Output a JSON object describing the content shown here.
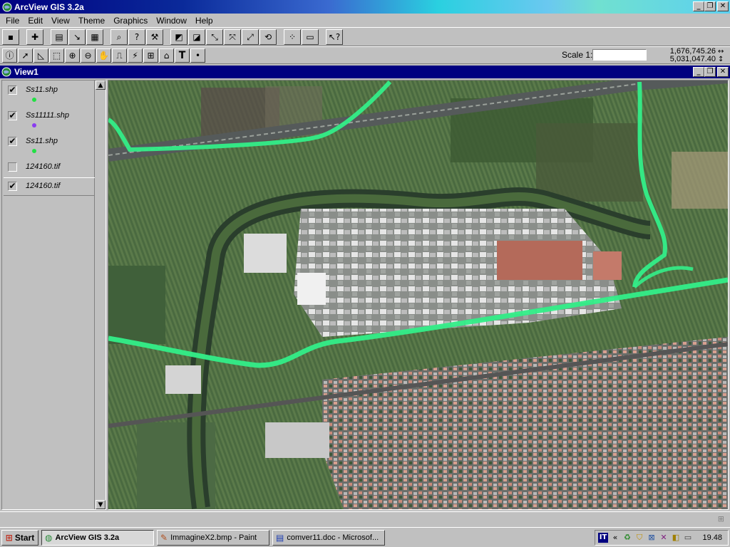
{
  "app": {
    "title": "ArcView GIS 3.2a",
    "window_buttons": {
      "minimize": "_",
      "maximize": "❐",
      "close": "✕"
    }
  },
  "menu": [
    "File",
    "Edit",
    "View",
    "Theme",
    "Graphics",
    "Window",
    "Help"
  ],
  "toolbar_buttons": [
    "save-icon",
    "add-theme-icon",
    "theme-properties-icon",
    "edit-legend-icon",
    "open-table-icon",
    "find-icon",
    "locate-address-icon",
    "query-builder-icon",
    "zoom-full-extent-icon",
    "zoom-active-themes-icon",
    "zoom-selected-icon",
    "zoom-in-icon",
    "zoom-out-icon",
    "zoom-previous-icon",
    "select-by-theme-icon",
    "clear-selection-icon",
    "help-icon"
  ],
  "tool_buttons": [
    "identify-icon",
    "pointer-icon",
    "vertex-edit-icon",
    "select-feature-icon",
    "zoom-in-tool-icon",
    "zoom-out-tool-icon",
    "pan-icon",
    "measure-icon",
    "hotlink-icon",
    "area-of-interest-icon",
    "label-icon",
    "text-icon",
    "draw-point-icon"
  ],
  "scale": {
    "label": "Scale 1:",
    "value": ""
  },
  "coordinates": {
    "x": "1,676,745.26",
    "y": "5,031,047.40"
  },
  "view": {
    "title": "View1",
    "window_buttons": {
      "minimize": "_",
      "maximize": "❐",
      "close": "✕"
    }
  },
  "themes": [
    {
      "name": "Ss11.shp",
      "checked": true,
      "symbol_color": "#22e044"
    },
    {
      "name": "Ss11111.shp",
      "checked": true,
      "symbol_color": "#8a3cf0"
    },
    {
      "name": "Ss11.shp",
      "checked": true,
      "symbol_color": "#22e044"
    },
    {
      "name": "124160.tif",
      "checked": false,
      "symbol_color": ""
    },
    {
      "name": "124160.tif",
      "checked": true,
      "symbol_color": ""
    }
  ],
  "colors": {
    "road_line": "#33ee88",
    "title_active": "#000080"
  },
  "taskbar": {
    "start_label": "Start",
    "tasks": [
      {
        "label": "ArcView GIS 3.2a",
        "active": true
      },
      {
        "label": "ImmagineX2.bmp - Paint",
        "active": false
      },
      {
        "label": "comver11.doc - Microsof...",
        "active": false
      }
    ],
    "tray": {
      "lang": "IT",
      "arrows": "«",
      "clock": "19.48"
    }
  }
}
